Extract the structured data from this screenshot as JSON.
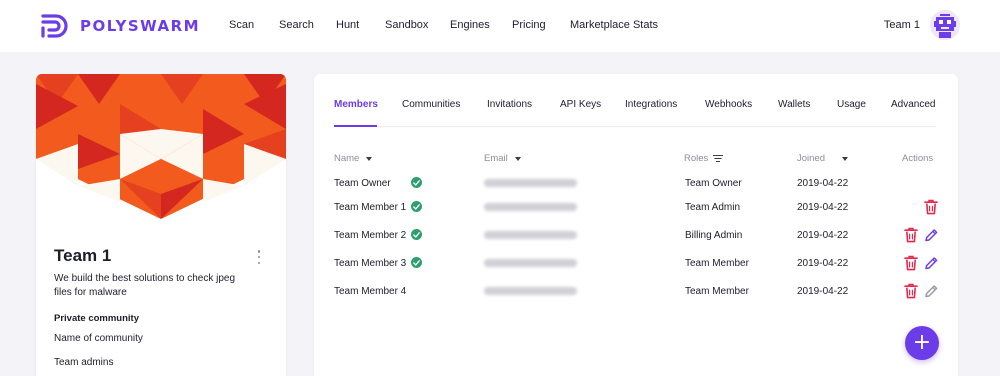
{
  "brand": {
    "name": "POLYSWARM",
    "color": "#6c3ce9"
  },
  "nav": {
    "items": [
      "Scan",
      "Search",
      "Hunt",
      "Sandbox",
      "Engines",
      "Pricing",
      "Marketplace Stats"
    ],
    "team": "Team 1",
    "avatar_icon": "robot-avatar-icon"
  },
  "team_card": {
    "name": "Team 1",
    "description": "We build the best solutions to check jpeg files for malware",
    "community_title": "Private community",
    "community_name": "Name of community",
    "admins_title": "Team admins"
  },
  "tabs": {
    "items": [
      "Members",
      "Communities",
      "Invitations",
      "API Keys",
      "Integrations",
      "Webhooks",
      "Wallets",
      "Usage",
      "Advanced"
    ],
    "active": "Members"
  },
  "table": {
    "headers": {
      "name": "Name",
      "email": "Email",
      "roles": "Roles",
      "joined": "Joined",
      "actions": "Actions"
    },
    "rows": [
      {
        "name": "Team Owner",
        "verified": true,
        "email_redacted": true,
        "role": "Team Owner",
        "joined": "2019-04-22",
        "can_delete": false,
        "can_edit": false,
        "edit_enabled": false
      },
      {
        "name": "Team Member 1",
        "verified": true,
        "email_redacted": true,
        "role": "Team Admin",
        "joined": "2019-04-22",
        "can_delete": true,
        "can_edit": false,
        "edit_enabled": false
      },
      {
        "name": "Team Member 2",
        "verified": true,
        "email_redacted": true,
        "role": "Billing Admin",
        "joined": "2019-04-22",
        "can_delete": true,
        "can_edit": true,
        "edit_enabled": true
      },
      {
        "name": "Team Member 3",
        "verified": true,
        "email_redacted": true,
        "role": "Team Member",
        "joined": "2019-04-22",
        "can_delete": true,
        "can_edit": true,
        "edit_enabled": true
      },
      {
        "name": "Team Member 4",
        "verified": false,
        "email_redacted": true,
        "role": "Team Member",
        "joined": "2019-04-22",
        "can_delete": true,
        "can_edit": true,
        "edit_enabled": false
      }
    ]
  },
  "add_button_label": "+",
  "colors": {
    "accent": "#6c3ce9",
    "delete": "#e5274a",
    "verified": "#2f9e6e",
    "muted": "#8d8d9a",
    "banner_orange": "#f25a1e",
    "banner_red": "#d3271f",
    "banner_cream": "#fdf8ef"
  }
}
